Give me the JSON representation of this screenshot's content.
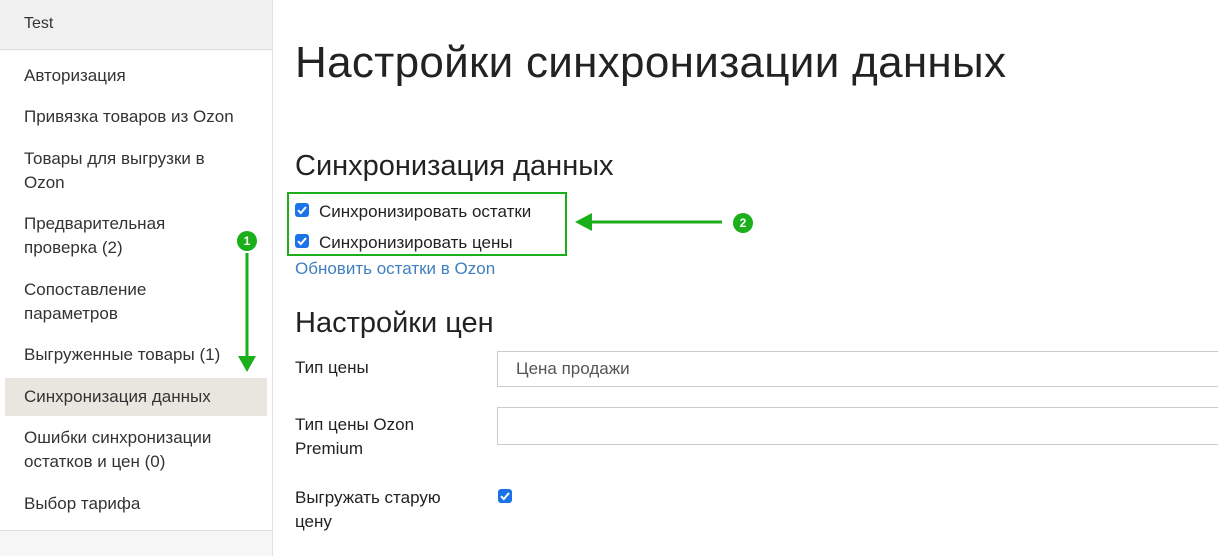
{
  "sidebar": {
    "title": "Test",
    "items": [
      {
        "label": "Авторизация"
      },
      {
        "label": "Привязка товаров из Ozon"
      },
      {
        "label": "Товары для выгрузки в Ozon"
      },
      {
        "label": "Предварительная проверка (2)"
      },
      {
        "label": "Сопоставление параметров"
      },
      {
        "label": "Выгруженные товары (1)"
      },
      {
        "label": "Синхронизация данных",
        "active": true
      },
      {
        "label": "Ошибки синхронизации остатков и цен (0)"
      },
      {
        "label": "Выбор тарифа"
      }
    ]
  },
  "main": {
    "page_title": "Настройки синхронизации данных",
    "sync_section": {
      "title": "Синхронизация данных",
      "sync_stock_label": "Синхронизировать остатки",
      "sync_stock_checked": true,
      "sync_prices_label": "Синхронизировать цены",
      "sync_prices_checked": true,
      "refresh_link": "Обновить остатки в Ozon"
    },
    "price_section": {
      "title": "Настройки цен",
      "price_type_label": "Тип цены",
      "price_type_value": "Цена продажи",
      "premium_price_label": "Тип цены Ozon Premium",
      "premium_price_value": "",
      "old_price_label": "Выгружать старую цену",
      "old_price_checked": true
    }
  },
  "annotations": {
    "badge_1": "1",
    "badge_2": "2",
    "color": "#1bb01b"
  },
  "colors": {
    "accent": "#1a73e8",
    "link": "#3f7fbf",
    "active_item_bg": "#e8e6df"
  }
}
